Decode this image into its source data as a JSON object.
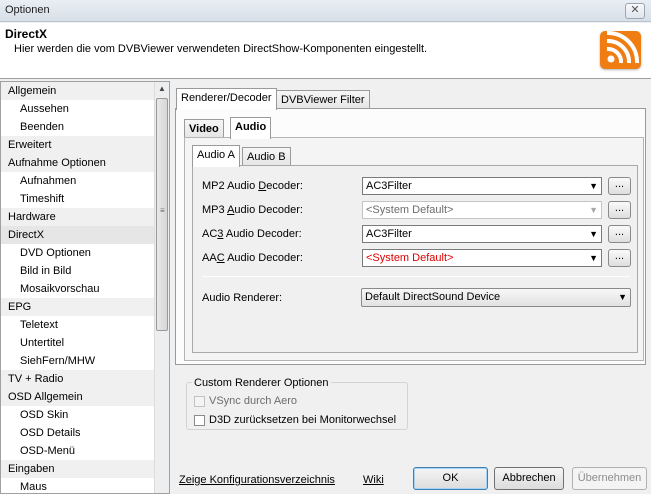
{
  "window": {
    "title": "Optionen",
    "close_label": "✕"
  },
  "header": {
    "title": "DirectX",
    "description": "Hier werden die vom DVBViewer verwendeten DirectShow-Komponenten eingestellt.",
    "logo_icon": "dvbviewer-logo-icon",
    "accent_color": "#ef7d12"
  },
  "tree": {
    "items": [
      {
        "label": "Allgemein",
        "level": 0
      },
      {
        "label": "Aussehen",
        "level": 1
      },
      {
        "label": "Beenden",
        "level": 1
      },
      {
        "label": "Erweitert",
        "level": 0
      },
      {
        "label": "Aufnahme Optionen",
        "level": 0
      },
      {
        "label": "Aufnahmen",
        "level": 1
      },
      {
        "label": "Timeshift",
        "level": 1
      },
      {
        "label": "Hardware",
        "level": 0
      },
      {
        "label": "DirectX",
        "level": 0,
        "selected": true
      },
      {
        "label": "DVD Optionen",
        "level": 1
      },
      {
        "label": "Bild in Bild",
        "level": 1
      },
      {
        "label": "Mosaikvorschau",
        "level": 1
      },
      {
        "label": "EPG",
        "level": 0
      },
      {
        "label": "Teletext",
        "level": 1
      },
      {
        "label": "Untertitel",
        "level": 1
      },
      {
        "label": "SiehFern/MHW",
        "level": 1
      },
      {
        "label": "TV + Radio",
        "level": 0
      },
      {
        "label": "OSD Allgemein",
        "level": 0
      },
      {
        "label": "OSD Skin",
        "level": 1
      },
      {
        "label": "OSD Details",
        "level": 1
      },
      {
        "label": "OSD-Menü",
        "level": 1
      },
      {
        "label": "Eingaben",
        "level": 0
      },
      {
        "label": "Maus",
        "level": 1
      }
    ]
  },
  "tabs": {
    "outer": [
      "Renderer/Decoder",
      "DVBViewer Filter"
    ],
    "mid": [
      "Video",
      "Audio"
    ],
    "inner": [
      "Audio A",
      "Audio B"
    ]
  },
  "decoders": {
    "mp2": {
      "label_pre": "MP2 Audio ",
      "label_u": "D",
      "label_post": "ecoder:",
      "value": "AC3Filter"
    },
    "mp3": {
      "label_pre": "MP3 ",
      "label_u": "A",
      "label_post": "udio Decoder:",
      "value": "<System Default>"
    },
    "ac3": {
      "label_pre": "AC",
      "label_u": "3",
      "label_post": " Audio Decoder:",
      "value": "AC3Filter"
    },
    "aac": {
      "label_pre": "AA",
      "label_u": "C",
      "label_post": " Audio Decoder:",
      "value": "<System Default>"
    },
    "dots_label": "...",
    "arrow": "▼"
  },
  "renderer": {
    "label": "Audio Renderer:",
    "value": "Default DirectSound Device"
  },
  "custom": {
    "title": "Custom Renderer Optionen",
    "vsync": "VSync durch Aero",
    "d3d": "D3D zurücksetzen bei Monitorwechsel"
  },
  "footer": {
    "config_link": "Zeige Konfigurationsverzeichnis",
    "wiki_link": "Wiki",
    "ok": "OK",
    "cancel": "Abbrechen",
    "apply": "Übernehmen"
  },
  "scroll": {
    "up_arrow": "▲",
    "grip": "≡"
  }
}
